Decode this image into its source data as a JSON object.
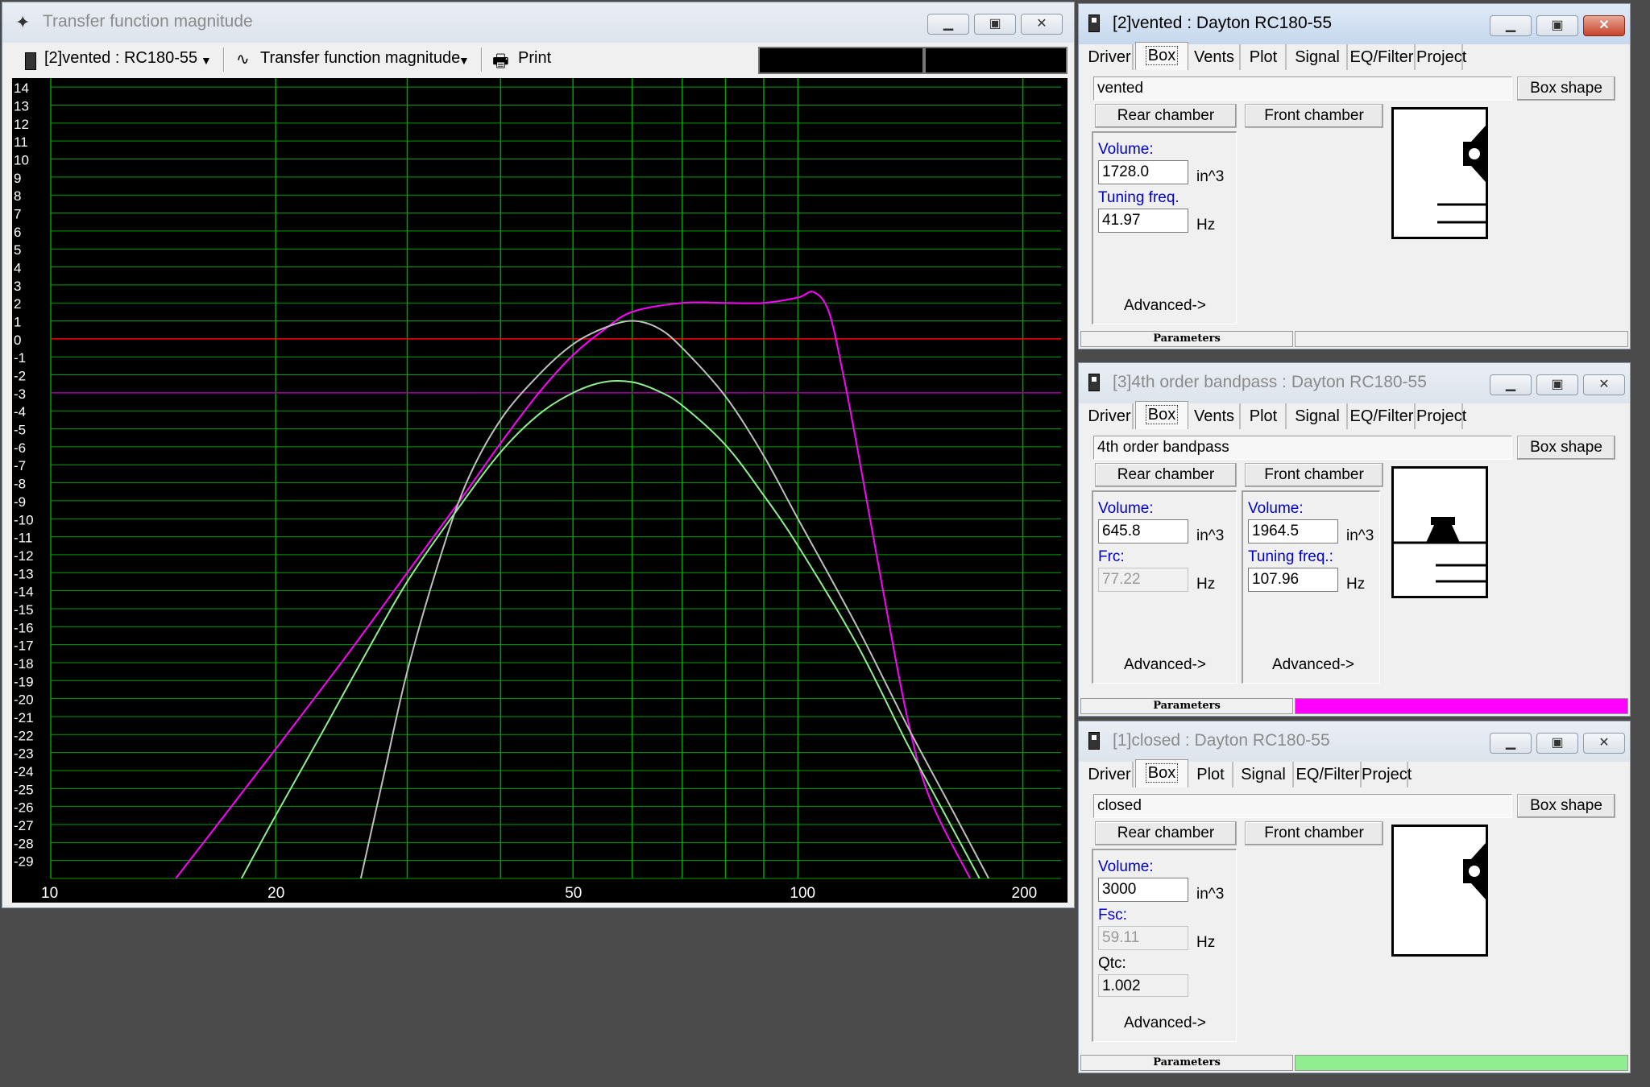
{
  "plot_window": {
    "title": "Transfer function magnitude",
    "toolbar": {
      "system_select": "[2]vented : RC180-55",
      "graph_select": "Transfer function magnitude",
      "print_label": "Print"
    }
  },
  "chart_data": {
    "type": "line",
    "xscale": "log",
    "xlim": [
      10,
      225
    ],
    "ylim": [
      -30,
      14.5
    ],
    "x_ticks": [
      "10",
      "20",
      "50",
      "100",
      "200"
    ],
    "y_ticks": [
      "14",
      "13",
      "12",
      "11",
      "10",
      "9",
      "8",
      "7",
      "6",
      "5",
      "4",
      "3",
      "2",
      "1",
      "0",
      "-1",
      "-2",
      "-3",
      "-4",
      "-5",
      "-6",
      "-7",
      "-8",
      "-9",
      "-10",
      "-11",
      "-12",
      "-13",
      "-14",
      "-15",
      "-16",
      "-17",
      "-18",
      "-19",
      "-20",
      "-21",
      "-22",
      "-23",
      "-24",
      "-25",
      "-26",
      "-27",
      "-28",
      "-29"
    ],
    "reference_lines": [
      {
        "y": 0,
        "color": "#ff0000"
      },
      {
        "y": -3,
        "color": "#a000a0"
      }
    ],
    "grid": true,
    "background": "#000000",
    "grid_color": "#00a000",
    "series": [
      {
        "color": "#ff00ff",
        "points": [
          [
            14.7,
            -30
          ],
          [
            20,
            -22.8
          ],
          [
            25,
            -17.5
          ],
          [
            30,
            -13
          ],
          [
            35,
            -9.2
          ],
          [
            40,
            -5.8
          ],
          [
            45,
            -3
          ],
          [
            50,
            -0.9
          ],
          [
            55,
            0.5
          ],
          [
            60,
            1.5
          ],
          [
            70,
            2.0
          ],
          [
            80,
            2.0
          ],
          [
            90,
            2.0
          ],
          [
            100,
            2.3
          ],
          [
            105,
            2.6
          ],
          [
            110,
            1.5
          ],
          [
            115,
            -2
          ],
          [
            120,
            -6
          ],
          [
            130,
            -14
          ],
          [
            140,
            -21
          ],
          [
            150,
            -25.5
          ],
          [
            170,
            -30
          ]
        ]
      },
      {
        "color": "#bfbfbf",
        "points": [
          [
            26,
            -30
          ],
          [
            28,
            -24
          ],
          [
            30,
            -18.5
          ],
          [
            33,
            -12.5
          ],
          [
            36,
            -8
          ],
          [
            40,
            -4.5
          ],
          [
            45,
            -2
          ],
          [
            50,
            -0.3
          ],
          [
            55,
            0.6
          ],
          [
            60,
            1.0
          ],
          [
            65,
            0.6
          ],
          [
            70,
            -0.5
          ],
          [
            80,
            -3.2
          ],
          [
            90,
            -6.5
          ],
          [
            100,
            -10
          ],
          [
            120,
            -16
          ],
          [
            140,
            -21.5
          ],
          [
            160,
            -26
          ],
          [
            180,
            -30
          ]
        ]
      },
      {
        "color": "#90ee90",
        "points": [
          [
            18,
            -30
          ],
          [
            20,
            -26.5
          ],
          [
            23,
            -22
          ],
          [
            26,
            -18
          ],
          [
            30,
            -13.5
          ],
          [
            35,
            -9.5
          ],
          [
            40,
            -6.3
          ],
          [
            45,
            -4.2
          ],
          [
            50,
            -3
          ],
          [
            55,
            -2.4
          ],
          [
            60,
            -2.4
          ],
          [
            65,
            -2.9
          ],
          [
            70,
            -3.7
          ],
          [
            80,
            -5.9
          ],
          [
            90,
            -8.7
          ],
          [
            100,
            -11.5
          ],
          [
            120,
            -17
          ],
          [
            140,
            -22.5
          ],
          [
            160,
            -27
          ],
          [
            175,
            -30
          ]
        ]
      }
    ]
  },
  "windows": [
    {
      "title": "[2]vented : Dayton RC180-55",
      "tabs": [
        "Driver",
        "Box",
        "Vents",
        "Plot",
        "Signal",
        "EQ/Filter",
        "Project"
      ],
      "selected_tab": "Box",
      "box_type": "vented",
      "box_shape_label": "Box shape",
      "rear_chamber_label": "Rear chamber",
      "front_chamber_label": "Front chamber",
      "rear": {
        "volume_label": "Volume:",
        "volume": "1728.0",
        "volume_unit": "in^3",
        "f_label": "Tuning freq.",
        "f_value": "41.97",
        "f_unit": "Hz",
        "advanced": "Advanced->"
      },
      "status_label": "Parameters",
      "status_color": "#f0f0f0"
    },
    {
      "title": "[3]4th order bandpass : Dayton RC180-55",
      "tabs": [
        "Driver",
        "Box",
        "Vents",
        "Plot",
        "Signal",
        "EQ/Filter",
        "Project"
      ],
      "selected_tab": "Box",
      "box_type": "4th order bandpass",
      "box_shape_label": "Box shape",
      "rear_chamber_label": "Rear chamber",
      "front_chamber_label": "Front chamber",
      "rear": {
        "volume_label": "Volume:",
        "volume": "645.8",
        "volume_unit": "in^3",
        "f_label": "Frc:",
        "f_value": "77.22",
        "f_unit": "Hz",
        "advanced": "Advanced->"
      },
      "front": {
        "volume_label": "Volume:",
        "volume": "1964.5",
        "volume_unit": "in^3",
        "f_label": "Tuning freq.:",
        "f_value": "107.96",
        "f_unit": "Hz",
        "advanced": "Advanced->"
      },
      "status_label": "Parameters",
      "status_color": "#ff00ff"
    },
    {
      "title": "[1]closed : Dayton RC180-55",
      "tabs": [
        "Driver",
        "Box",
        "Plot",
        "Signal",
        "EQ/Filter",
        "Project"
      ],
      "selected_tab": "Box",
      "box_type": "closed",
      "box_shape_label": "Box shape",
      "rear_chamber_label": "Rear chamber",
      "front_chamber_label": "Front chamber",
      "rear": {
        "volume_label": "Volume:",
        "volume": "3000",
        "volume_unit": "in^3",
        "f_label": "Fsc:",
        "f_value": "59.11",
        "f_unit": "Hz",
        "q_label": "Qtc:",
        "q_value": "1.002",
        "advanced": "Advanced->"
      },
      "status_label": "Parameters",
      "status_color": "#90ee90"
    }
  ]
}
